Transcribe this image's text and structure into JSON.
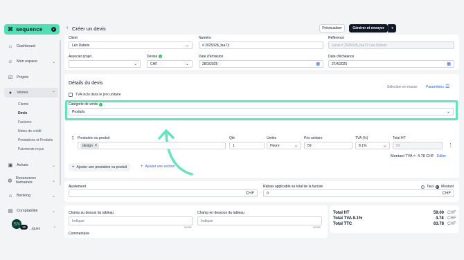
{
  "brand": {
    "name": "sequence",
    "mark": "⌘"
  },
  "sidebar": {
    "items": [
      {
        "label": "Dashboard",
        "icon": "home-icon"
      },
      {
        "label": "Mon espace",
        "icon": "user-icon"
      },
      {
        "label": "Projets",
        "icon": "checkbox-icon"
      },
      {
        "label": "Ventes",
        "icon": "money-bag-icon"
      },
      {
        "label": "Achats",
        "icon": "bag-icon"
      },
      {
        "label": "Ressources humaines",
        "icon": "globe-icon"
      },
      {
        "label": "Banking",
        "icon": "bank-icon"
      },
      {
        "label": "Comptabilité",
        "icon": "book-icon"
      }
    ],
    "ventes_sub": [
      "Clients",
      "Devis",
      "Factures",
      "Notes de crédit",
      "Prestations et Produits",
      "Paiements reçus"
    ],
    "user": {
      "initials": "SN",
      "name": "...igues",
      "badge": "16"
    }
  },
  "header": {
    "title": "Créer un devis",
    "preview_label": "Prévisualiser",
    "generate_label": "Générer et envoyer"
  },
  "form": {
    "client_label": "Client",
    "client_value": "Léo Dubois",
    "numero_label": "Numéro",
    "numero_value": "# 2025328_faa73",
    "reference_label": "Référence",
    "reference_value": "Devis # 2025328_faa73 Léo  Dubois",
    "projet_label": "Associer projet",
    "projet_value": "",
    "devise_label": "Devise",
    "devise_value": "CHF",
    "emission_label": "Date d'émission",
    "emission_value": "28/3/2025",
    "echeance_label": "Date d'échéance",
    "echeance_value": "27/4/2025"
  },
  "details": {
    "title": "Détails du devis",
    "selection_mode": "Sélection en masse",
    "params_label": "Paramètres",
    "tva_incl_label": "TVA inclu dans le prix unitaire",
    "categorie_label": "Catégorie de vente",
    "categorie_value": "Produits",
    "columns": {
      "prestation": "Prestation ou produit",
      "qte": "Qté",
      "unites": "Unités",
      "prix": "Prix unitaire",
      "tva": "TVA (%)",
      "total": "Total HT"
    },
    "line": {
      "tag": "design",
      "qte": "1",
      "unite": "Heure",
      "prix": "59",
      "tva": "8.1%",
      "total": "59"
    },
    "montant_tva_label": "Montant TVA =",
    "montant_tva_value": "4.78 CHF",
    "edit_label": "Editer",
    "add_product_label": "Ajouter une prestation ou produit",
    "add_section_label": "Ajouter une section"
  },
  "adjust": {
    "ajustement_label": "Ajustement",
    "ajustement_currency": "CHF",
    "rabais_label": "Rabais applicable au total de la facture",
    "rabais_value": "0",
    "rabais_currency": "CHF",
    "taux_label": "Taux",
    "montant_label": "Montant"
  },
  "bottom": {
    "champ_dessus_label": "Champ au dessus du tableau",
    "champ_dessous_label": "Champ en dessous du tableau",
    "placeholder": "Indiquer",
    "counter": "0/1000",
    "commentaire_label": "Commentaire"
  },
  "totals": {
    "ht_label": "Total HT",
    "ht_value": "59.00",
    "tva_label": "Total TVA 8.1%",
    "tva_value": "4.78",
    "ttc_label": "Total TTC",
    "ttc_value": "63.78",
    "currency": "CHF"
  },
  "colors": {
    "accent": "#4ee1b7",
    "highlight": "#5ee7bd",
    "primary": "#111827",
    "link": "#2563eb"
  }
}
